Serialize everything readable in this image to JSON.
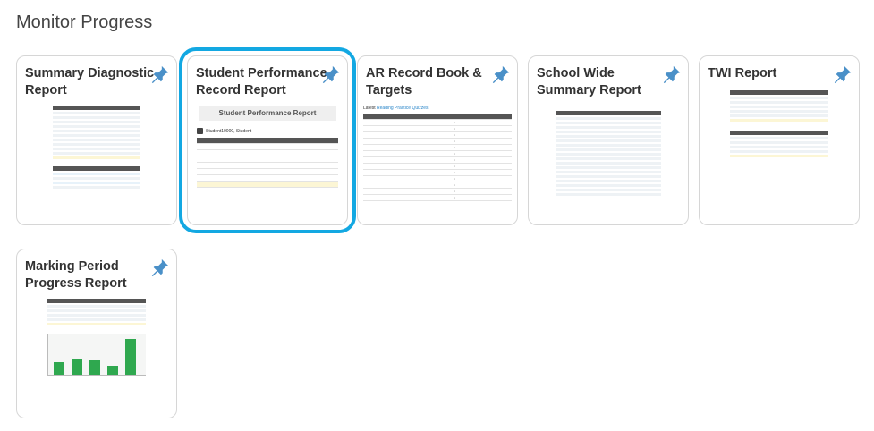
{
  "section": {
    "title": "Monitor Progress"
  },
  "cards": [
    {
      "title": "Summary Diagnostic Report",
      "selected": false
    },
    {
      "title": "Student Performance Record Report",
      "selected": true
    },
    {
      "title": "AR Record Book & Targets",
      "selected": false
    },
    {
      "title": "School Wide Summary Report",
      "selected": false
    },
    {
      "title": "TWI Report",
      "selected": false
    },
    {
      "title": "Marking Period Progress Report",
      "selected": false
    }
  ],
  "thumbnails": {
    "spr": {
      "banner": "Student Performance Report",
      "student": "Student10000, Student"
    },
    "ar": {
      "label_prefix": "Latest",
      "label_link": "Reading Practice Quizzes"
    }
  },
  "colors": {
    "selected_outline": "#13a8e2",
    "pin": "#4a90c8",
    "chart_bar": "#2fa84f"
  },
  "icons": {
    "pin": "pushpin-icon"
  }
}
